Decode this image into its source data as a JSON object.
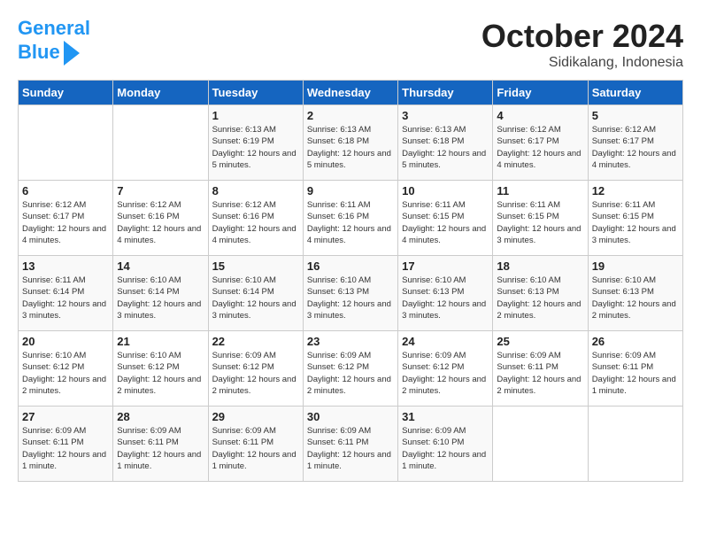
{
  "header": {
    "logo_line1": "General",
    "logo_line2": "Blue",
    "month": "October 2024",
    "location": "Sidikalang, Indonesia"
  },
  "days_of_week": [
    "Sunday",
    "Monday",
    "Tuesday",
    "Wednesday",
    "Thursday",
    "Friday",
    "Saturday"
  ],
  "weeks": [
    [
      {
        "day": "",
        "info": ""
      },
      {
        "day": "",
        "info": ""
      },
      {
        "day": "1",
        "info": "Sunrise: 6:13 AM\nSunset: 6:19 PM\nDaylight: 12 hours\nand 5 minutes."
      },
      {
        "day": "2",
        "info": "Sunrise: 6:13 AM\nSunset: 6:18 PM\nDaylight: 12 hours\nand 5 minutes."
      },
      {
        "day": "3",
        "info": "Sunrise: 6:13 AM\nSunset: 6:18 PM\nDaylight: 12 hours\nand 5 minutes."
      },
      {
        "day": "4",
        "info": "Sunrise: 6:12 AM\nSunset: 6:17 PM\nDaylight: 12 hours\nand 4 minutes."
      },
      {
        "day": "5",
        "info": "Sunrise: 6:12 AM\nSunset: 6:17 PM\nDaylight: 12 hours\nand 4 minutes."
      }
    ],
    [
      {
        "day": "6",
        "info": "Sunrise: 6:12 AM\nSunset: 6:17 PM\nDaylight: 12 hours\nand 4 minutes."
      },
      {
        "day": "7",
        "info": "Sunrise: 6:12 AM\nSunset: 6:16 PM\nDaylight: 12 hours\nand 4 minutes."
      },
      {
        "day": "8",
        "info": "Sunrise: 6:12 AM\nSunset: 6:16 PM\nDaylight: 12 hours\nand 4 minutes."
      },
      {
        "day": "9",
        "info": "Sunrise: 6:11 AM\nSunset: 6:16 PM\nDaylight: 12 hours\nand 4 minutes."
      },
      {
        "day": "10",
        "info": "Sunrise: 6:11 AM\nSunset: 6:15 PM\nDaylight: 12 hours\nand 4 minutes."
      },
      {
        "day": "11",
        "info": "Sunrise: 6:11 AM\nSunset: 6:15 PM\nDaylight: 12 hours\nand 3 minutes."
      },
      {
        "day": "12",
        "info": "Sunrise: 6:11 AM\nSunset: 6:15 PM\nDaylight: 12 hours\nand 3 minutes."
      }
    ],
    [
      {
        "day": "13",
        "info": "Sunrise: 6:11 AM\nSunset: 6:14 PM\nDaylight: 12 hours\nand 3 minutes."
      },
      {
        "day": "14",
        "info": "Sunrise: 6:10 AM\nSunset: 6:14 PM\nDaylight: 12 hours\nand 3 minutes."
      },
      {
        "day": "15",
        "info": "Sunrise: 6:10 AM\nSunset: 6:14 PM\nDaylight: 12 hours\nand 3 minutes."
      },
      {
        "day": "16",
        "info": "Sunrise: 6:10 AM\nSunset: 6:13 PM\nDaylight: 12 hours\nand 3 minutes."
      },
      {
        "day": "17",
        "info": "Sunrise: 6:10 AM\nSunset: 6:13 PM\nDaylight: 12 hours\nand 3 minutes."
      },
      {
        "day": "18",
        "info": "Sunrise: 6:10 AM\nSunset: 6:13 PM\nDaylight: 12 hours\nand 2 minutes."
      },
      {
        "day": "19",
        "info": "Sunrise: 6:10 AM\nSunset: 6:13 PM\nDaylight: 12 hours\nand 2 minutes."
      }
    ],
    [
      {
        "day": "20",
        "info": "Sunrise: 6:10 AM\nSunset: 6:12 PM\nDaylight: 12 hours\nand 2 minutes."
      },
      {
        "day": "21",
        "info": "Sunrise: 6:10 AM\nSunset: 6:12 PM\nDaylight: 12 hours\nand 2 minutes."
      },
      {
        "day": "22",
        "info": "Sunrise: 6:09 AM\nSunset: 6:12 PM\nDaylight: 12 hours\nand 2 minutes."
      },
      {
        "day": "23",
        "info": "Sunrise: 6:09 AM\nSunset: 6:12 PM\nDaylight: 12 hours\nand 2 minutes."
      },
      {
        "day": "24",
        "info": "Sunrise: 6:09 AM\nSunset: 6:12 PM\nDaylight: 12 hours\nand 2 minutes."
      },
      {
        "day": "25",
        "info": "Sunrise: 6:09 AM\nSunset: 6:11 PM\nDaylight: 12 hours\nand 2 minutes."
      },
      {
        "day": "26",
        "info": "Sunrise: 6:09 AM\nSunset: 6:11 PM\nDaylight: 12 hours\nand 1 minute."
      }
    ],
    [
      {
        "day": "27",
        "info": "Sunrise: 6:09 AM\nSunset: 6:11 PM\nDaylight: 12 hours\nand 1 minute."
      },
      {
        "day": "28",
        "info": "Sunrise: 6:09 AM\nSunset: 6:11 PM\nDaylight: 12 hours\nand 1 minute."
      },
      {
        "day": "29",
        "info": "Sunrise: 6:09 AM\nSunset: 6:11 PM\nDaylight: 12 hours\nand 1 minute."
      },
      {
        "day": "30",
        "info": "Sunrise: 6:09 AM\nSunset: 6:11 PM\nDaylight: 12 hours\nand 1 minute."
      },
      {
        "day": "31",
        "info": "Sunrise: 6:09 AM\nSunset: 6:10 PM\nDaylight: 12 hours\nand 1 minute."
      },
      {
        "day": "",
        "info": ""
      },
      {
        "day": "",
        "info": ""
      }
    ]
  ]
}
